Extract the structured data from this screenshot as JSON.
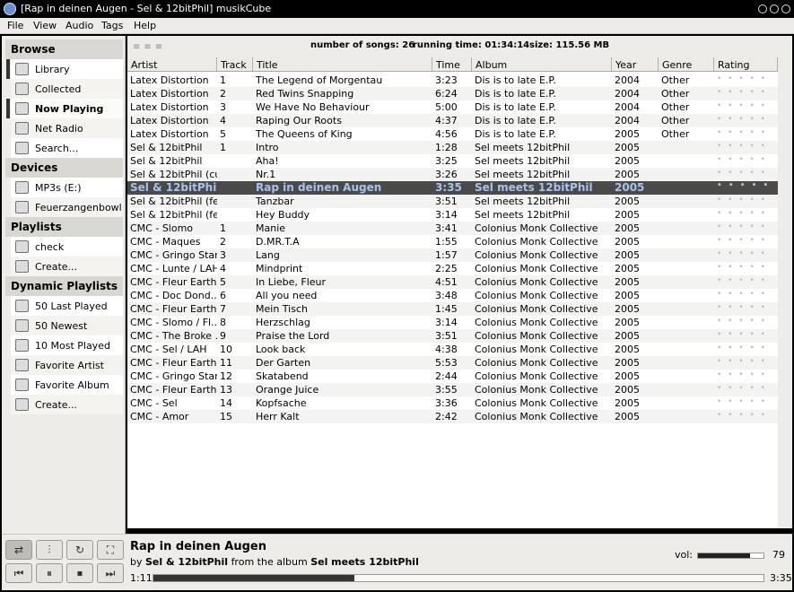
{
  "window": {
    "title": "[Rap in deinen Augen - Sel & 12bitPhil] musikCube"
  },
  "menu": [
    "File",
    "View",
    "Audio",
    "Tags",
    "Help"
  ],
  "sidebar": {
    "sections": [
      {
        "header": "Browse",
        "items": [
          {
            "label": "Library",
            "icon": "library-icon"
          },
          {
            "label": "Collected",
            "icon": "collected-icon"
          },
          {
            "label": "Now Playing",
            "icon": "music-note-icon",
            "selected": true
          },
          {
            "label": "Net Radio",
            "icon": "globe-icon"
          },
          {
            "label": "Search...",
            "icon": "search-icon"
          }
        ]
      },
      {
        "header": "Devices",
        "items": [
          {
            "label": "MP3s (E:)",
            "icon": "drive-icon"
          },
          {
            "label": "Feuerzangenbowl...",
            "icon": "cd-icon"
          }
        ]
      },
      {
        "header": "Playlists",
        "items": [
          {
            "label": "check",
            "icon": "playlist-icon"
          },
          {
            "label": "Create...",
            "icon": "playlist-create-icon"
          }
        ]
      },
      {
        "header": "Dynamic Playlists",
        "items": [
          {
            "label": "50 Last Played",
            "icon": "dynamic-playlist-icon"
          },
          {
            "label": "50 Newest",
            "icon": "dynamic-playlist-icon"
          },
          {
            "label": "10 Most Played",
            "icon": "dynamic-playlist-icon"
          },
          {
            "label": "Favorite Artist",
            "icon": "dynamic-playlist-icon"
          },
          {
            "label": "Favorite Album",
            "icon": "dynamic-playlist-icon"
          },
          {
            "label": "Create...",
            "icon": "dynamic-playlist-create-icon"
          }
        ]
      }
    ]
  },
  "stats": {
    "songs": "number of songs: 26",
    "runtime": "running time: 01:34:14",
    "size": "size: 115.56 MB"
  },
  "columns": [
    "Artist",
    "Track",
    "Title",
    "Time",
    "Album",
    "Year",
    "Genre",
    "Rating"
  ],
  "tracks": [
    [
      "Latex Distortion",
      "1",
      "The Legend of Morgentau",
      "3:23",
      "Dis is to late E.P.",
      "2004",
      "Other"
    ],
    [
      "Latex Distortion",
      "2",
      "Red Twins Snapping",
      "6:24",
      "Dis is to late E.P.",
      "2004",
      "Other"
    ],
    [
      "Latex Distortion",
      "3",
      "We Have No Behaviour",
      "5:00",
      "Dis is to late E.P.",
      "2004",
      "Other"
    ],
    [
      "Latex Distortion",
      "4",
      "Raping Our Roots",
      "4:37",
      "Dis is to late E.P.",
      "2004",
      "Other"
    ],
    [
      "Latex Distortion",
      "5",
      "The Queens of King",
      "4:56",
      "Dis is to late E.P.",
      "2005",
      "Other"
    ],
    [
      "Sel & 12bitPhil",
      "1",
      "Intro",
      "1:28",
      "Sel meets 12bitPhil",
      "2005",
      ""
    ],
    [
      "Sel & 12bitPhil",
      "",
      "Aha!",
      "3:25",
      "Sel meets 12bitPhil",
      "2005",
      ""
    ],
    [
      "Sel & 12bitPhil (cu...",
      "",
      "Nr.1",
      "3:26",
      "Sel meets 12bitPhil",
      "2005",
      ""
    ],
    [
      "Sel & 12bitPhil",
      "",
      "Rap in deinen Augen",
      "3:35",
      "Sel meets 12bitPhil",
      "2005",
      ""
    ],
    [
      "Sel & 12bitPhil (fe...",
      "",
      "Tanzbar",
      "3:51",
      "Sel meets 12bitPhil",
      "2005",
      ""
    ],
    [
      "Sel & 12bitPhil (fe...",
      "",
      "Hey Buddy",
      "3:14",
      "Sel meets 12bitPhil",
      "2005",
      ""
    ],
    [
      "CMC - Slomo",
      "1",
      "Manie",
      "3:41",
      "Colonius Monk Collective",
      "2005",
      ""
    ],
    [
      "CMC - Maques",
      "2",
      "D.MR.T.A",
      "1:55",
      "Colonius Monk Collective",
      "2005",
      ""
    ],
    [
      "CMC - Gringo Starr",
      "3",
      "Lang",
      "1:57",
      "Colonius Monk Collective",
      "2005",
      ""
    ],
    [
      "CMC - Lunte / LAH",
      "4",
      "Mindprint",
      "2:25",
      "Colonius Monk Collective",
      "2005",
      ""
    ],
    [
      "CMC - Fleur Earth...",
      "5",
      "In Liebe, Fleur",
      "4:51",
      "Colonius Monk Collective",
      "2005",
      ""
    ],
    [
      "CMC - Doc Dond...",
      "6",
      "All you need",
      "3:48",
      "Colonius Monk Collective",
      "2005",
      ""
    ],
    [
      "CMC - Fleur Earth...",
      "7",
      "Mein Tisch",
      "1:45",
      "Colonius Monk Collective",
      "2005",
      ""
    ],
    [
      "CMC - Slomo / Fl...",
      "8",
      "Herzschlag",
      "3:14",
      "Colonius Monk Collective",
      "2005",
      ""
    ],
    [
      "CMC - The Broke ...",
      "9",
      "Praise the Lord",
      "3:51",
      "Colonius Monk Collective",
      "2005",
      ""
    ],
    [
      "CMC - Sel / LAH",
      "10",
      "Look back",
      "4:38",
      "Colonius Monk Collective",
      "2005",
      ""
    ],
    [
      "CMC - Fleur Earth",
      "11",
      "Der Garten",
      "5:53",
      "Colonius Monk Collective",
      "2005",
      ""
    ],
    [
      "CMC - Gringo Star...",
      "12",
      "Skatabend",
      "2:44",
      "Colonius Monk Collective",
      "2005",
      ""
    ],
    [
      "CMC - Fleur Earth...",
      "13",
      "Orange Juice",
      "3:55",
      "Colonius Monk Collective",
      "2005",
      ""
    ],
    [
      "CMC - Sel",
      "14",
      "Kopfsache",
      "3:36",
      "Colonius Monk Collective",
      "2005",
      ""
    ],
    [
      "CMC - Amor",
      "15",
      "Herr Kalt",
      "2:42",
      "Colonius Monk Collective",
      "2005",
      ""
    ]
  ],
  "playing_index": 8,
  "player": {
    "title": "Rap in deinen Augen",
    "by_prefix": "by",
    "artist": "Sel & 12bitPhil",
    "album_prefix": "from the album",
    "album": "Sel meets 12bitPhil",
    "elapsed": "1:11",
    "total": "3:35",
    "progress_fraction": 0.33,
    "volume_label": "vol:",
    "volume": "79",
    "volume_fraction": 0.79
  },
  "controls": {
    "top": [
      "shuffle-icon",
      "equalizer-icon",
      "repeat-icon",
      "visualizer-icon"
    ],
    "bottom": [
      "previous-icon",
      "pause-icon",
      "stop-icon",
      "next-icon"
    ]
  }
}
